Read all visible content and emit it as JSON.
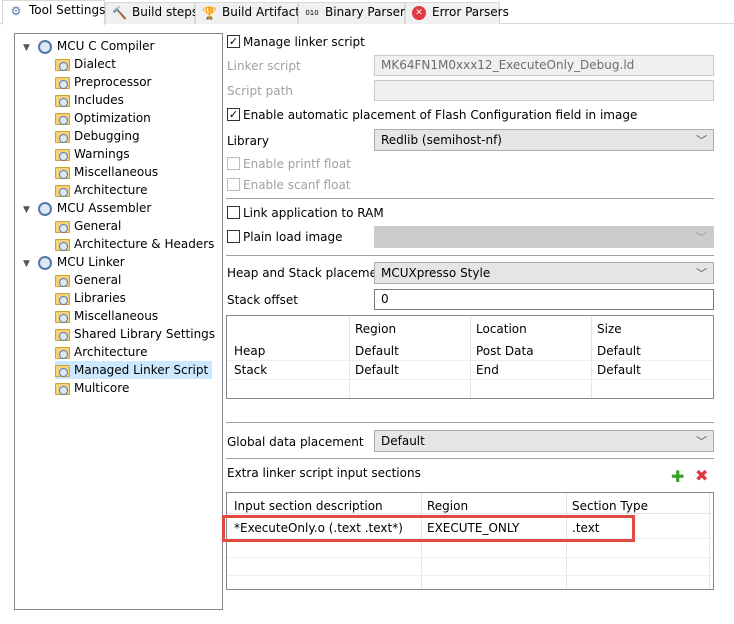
{
  "tabs": [
    {
      "label": "Tool Settings",
      "icon": "gear-icon"
    },
    {
      "label": "Build steps",
      "icon": "hammer-icon"
    },
    {
      "label": "Build Artifact",
      "icon": "trophy-icon"
    },
    {
      "label": "Binary Parsers",
      "icon": "binary-icon"
    },
    {
      "label": "Error Parsers",
      "icon": "error-icon"
    }
  ],
  "tree": {
    "compiler": {
      "label": "MCU C Compiler",
      "children": [
        "Dialect",
        "Preprocessor",
        "Includes",
        "Optimization",
        "Debugging",
        "Warnings",
        "Miscellaneous",
        "Architecture"
      ]
    },
    "assembler": {
      "label": "MCU Assembler",
      "children": [
        "General",
        "Architecture & Headers"
      ]
    },
    "linker": {
      "label": "MCU Linker",
      "children": [
        "General",
        "Libraries",
        "Miscellaneous",
        "Shared Library Settings",
        "Architecture",
        "Managed Linker Script",
        "Multicore"
      ]
    },
    "selected": "Managed Linker Script"
  },
  "form": {
    "manage_linker_script": {
      "label": "Manage linker script",
      "checked": true
    },
    "linker_script": {
      "label": "Linker script",
      "value": "MK64FN1M0xxx12_ExecuteOnly_Debug.ld"
    },
    "script_path": {
      "label": "Script path",
      "value": ""
    },
    "auto_flash_config": {
      "label": "Enable automatic placement of Flash Configuration field in image",
      "checked": true
    },
    "library": {
      "label": "Library",
      "value": "Redlib (semihost-nf)"
    },
    "printf_float": {
      "label": "Enable printf float",
      "checked": false
    },
    "scanf_float": {
      "label": "Enable scanf float",
      "checked": false
    },
    "link_to_ram": {
      "label": "Link application to RAM",
      "checked": false
    },
    "plain_load": {
      "label": "Plain load image",
      "checked": false,
      "value": ""
    },
    "heap_stack_placement": {
      "label": "Heap and Stack placement",
      "value": "MCUXpresso Style"
    },
    "stack_offset": {
      "label": "Stack offset",
      "value": "0"
    },
    "heap_stack_table": {
      "headers": [
        "",
        "Region",
        "Location",
        "Size"
      ],
      "rows": [
        [
          "Heap",
          "Default",
          "Post Data",
          "Default"
        ],
        [
          "Stack",
          "Default",
          "End",
          "Default"
        ]
      ]
    },
    "global_data_placement": {
      "label": "Global data placement",
      "value": "Default"
    },
    "extra_sections": {
      "label": "Extra linker script input sections",
      "headers": [
        "Input section description",
        "Region",
        "Section Type"
      ],
      "rows": [
        [
          "*ExecuteOnly.o (.text .text*)",
          "EXECUTE_ONLY",
          ".text"
        ]
      ],
      "highlight_color": "#e04a3f"
    }
  }
}
